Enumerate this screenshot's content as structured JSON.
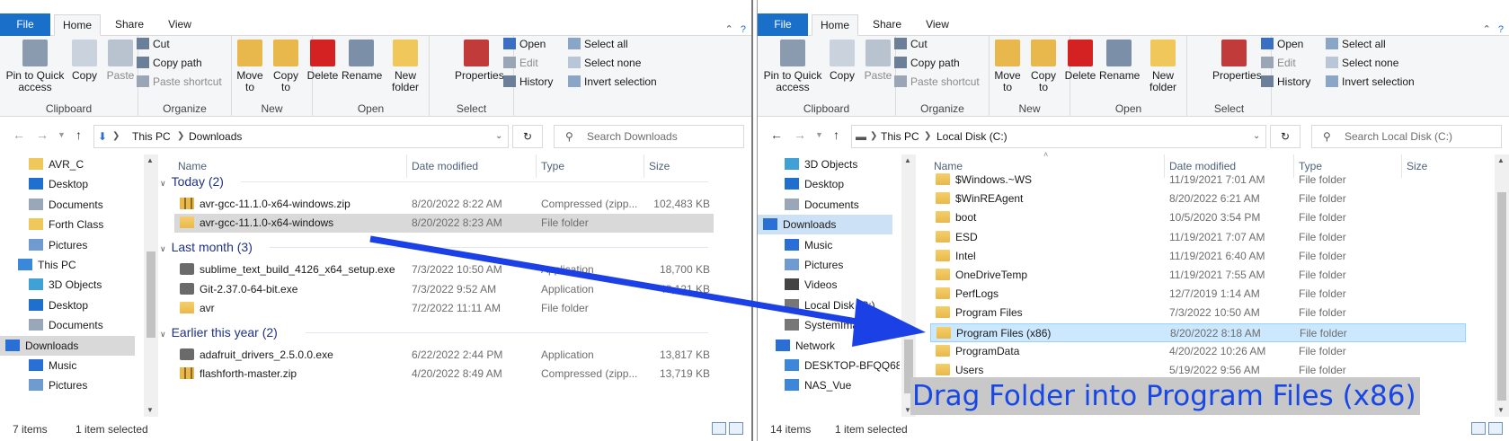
{
  "colors": {
    "accent": "#1a6fc9",
    "arrow": "#1a40e6",
    "caption_bg": "#c8c8c8"
  },
  "ribbon": {
    "tabs": [
      "File",
      "Home",
      "Share",
      "View"
    ],
    "pin": "Pin to Quick access",
    "copy": "Copy",
    "paste": "Paste",
    "cut": "Cut",
    "copy_path": "Copy path",
    "paste_shortcut": "Paste shortcut",
    "move_to": "Move to",
    "copy_to": "Copy to",
    "delete": "Delete",
    "rename": "Rename",
    "new_folder": "New folder",
    "properties": "Properties",
    "open": "Open",
    "edit": "Edit",
    "history": "History",
    "select_all": "Select all",
    "select_none": "Select none",
    "invert": "Invert selection",
    "groups": [
      "Clipboard",
      "Organize",
      "New",
      "Open",
      "Select"
    ]
  },
  "columns": {
    "name": "Name",
    "date": "Date modified",
    "type": "Type",
    "size": "Size"
  },
  "left": {
    "title": "Downloads",
    "crumbs": [
      "This PC",
      "Downloads"
    ],
    "search": "Search Downloads",
    "nav": [
      {
        "label": "AVR_C",
        "icon": "folder-icon"
      },
      {
        "label": "Desktop",
        "icon": "desktop-icon"
      },
      {
        "label": "Documents",
        "icon": "documents-icon"
      },
      {
        "label": "Forth Class",
        "icon": "folder-icon"
      },
      {
        "label": "Pictures",
        "icon": "pictures-icon"
      },
      {
        "label": "This PC",
        "icon": "this-pc-icon"
      },
      {
        "label": "3D Objects",
        "icon": "3d-objects-icon"
      },
      {
        "label": "Desktop",
        "icon": "desktop-icon"
      },
      {
        "label": "Documents",
        "icon": "documents-icon"
      },
      {
        "label": "Downloads",
        "icon": "downloads-icon"
      },
      {
        "label": "Music",
        "icon": "music-icon"
      },
      {
        "label": "Pictures",
        "icon": "pictures-icon"
      }
    ],
    "groups": [
      {
        "label": "Today (2)",
        "rows": [
          {
            "name": "avr-gcc-11.1.0-x64-windows.zip",
            "date": "8/20/2022 8:22 AM",
            "type": "Compressed (zipp...",
            "size": "102,483 KB",
            "kind": "zip"
          },
          {
            "name": "avr-gcc-11.1.0-x64-windows",
            "date": "8/20/2022 8:23 AM",
            "type": "File folder",
            "size": "",
            "kind": "folder"
          }
        ]
      },
      {
        "label": "Last month (3)",
        "rows": [
          {
            "name": "sublime_text_build_4126_x64_setup.exe",
            "date": "7/3/2022 10:50 AM",
            "type": "Application",
            "size": "18,700 KB",
            "kind": "exe"
          },
          {
            "name": "Git-2.37.0-64-bit.exe",
            "date": "7/3/2022 9:52 AM",
            "type": "Application",
            "size": "48,121 KB",
            "kind": "exe"
          },
          {
            "name": "avr",
            "date": "7/2/2022 11:11 AM",
            "type": "File folder",
            "size": "",
            "kind": "folder"
          }
        ]
      },
      {
        "label": "Earlier this year (2)",
        "rows": [
          {
            "name": "adafruit_drivers_2.5.0.0.exe",
            "date": "6/22/2022 2:44 PM",
            "type": "Application",
            "size": "13,817 KB",
            "kind": "exe"
          },
          {
            "name": "flashforth-master.zip",
            "date": "4/20/2022 8:49 AM",
            "type": "Compressed (zipp...",
            "size": "13,719 KB",
            "kind": "zip"
          }
        ]
      }
    ],
    "status_items": "7 items",
    "status_selected": "1 item selected"
  },
  "right": {
    "title": "Local Disk (C:)",
    "crumbs": [
      "This PC",
      "Local Disk (C:)"
    ],
    "search": "Search Local Disk (C:)",
    "nav": [
      {
        "label": "3D Objects",
        "icon": "3d-objects-icon"
      },
      {
        "label": "Desktop",
        "icon": "desktop-icon"
      },
      {
        "label": "Documents",
        "icon": "documents-icon"
      },
      {
        "label": "Downloads",
        "icon": "downloads-icon"
      },
      {
        "label": "Music",
        "icon": "music-icon"
      },
      {
        "label": "Pictures",
        "icon": "pictures-icon"
      },
      {
        "label": "Videos",
        "icon": "videos-icon"
      },
      {
        "label": "Local Disk (C:)",
        "icon": "drive-icon"
      },
      {
        "label": "SystemImage (D:)",
        "icon": "drive-icon"
      },
      {
        "label": "Network",
        "icon": "network-icon"
      },
      {
        "label": "DESKTOP-BFQQ68T",
        "icon": "computer-icon"
      },
      {
        "label": "NAS_Vue",
        "icon": "computer-icon"
      }
    ],
    "rows": [
      {
        "name": "$Windows.~WS",
        "date": "11/19/2021 7:01 AM",
        "type": "File folder"
      },
      {
        "name": "$WinREAgent",
        "date": "8/20/2022 6:21 AM",
        "type": "File folder"
      },
      {
        "name": "boot",
        "date": "10/5/2020 3:54 PM",
        "type": "File folder"
      },
      {
        "name": "ESD",
        "date": "11/19/2021 7:07 AM",
        "type": "File folder"
      },
      {
        "name": "Intel",
        "date": "11/19/2021 6:40 AM",
        "type": "File folder"
      },
      {
        "name": "OneDriveTemp",
        "date": "11/19/2021 7:55 AM",
        "type": "File folder"
      },
      {
        "name": "PerfLogs",
        "date": "12/7/2019 1:14 AM",
        "type": "File folder"
      },
      {
        "name": "Program Files",
        "date": "7/3/2022 10:50 AM",
        "type": "File folder"
      },
      {
        "name": "Program Files (x86)",
        "date": "8/20/2022 8:18 AM",
        "type": "File folder"
      },
      {
        "name": "ProgramData",
        "date": "4/20/2022 10:26 AM",
        "type": "File folder"
      },
      {
        "name": "Users",
        "date": "5/19/2022 9:56 AM",
        "type": "File folder"
      }
    ],
    "status_items": "14 items",
    "status_selected": "1 item selected"
  },
  "caption": "Drag Folder into Program Files (x86)"
}
